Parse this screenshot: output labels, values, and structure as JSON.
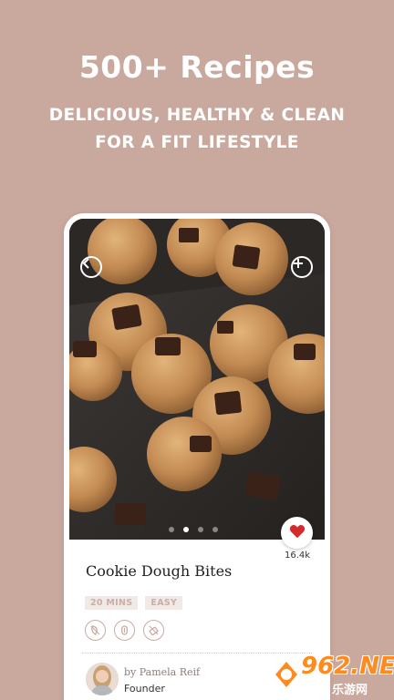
{
  "promo": {
    "headline": "500+ Recipes",
    "subline_1": "DELICIOUS, HEALTHY & CLEAN",
    "subline_2": "FOR A FIT LIFESTYLE"
  },
  "recipe": {
    "title": "Cookie Dough Bites",
    "likes": "16.4k",
    "tags": [
      "20 MINS",
      "EASY"
    ],
    "property_icons": [
      "vegan-icon",
      "gluten-free-icon",
      "sugar-free-icon"
    ],
    "author_line": "by Pamela Reif",
    "author_role": "Founder"
  },
  "carousel": {
    "total_images": 4,
    "active_index": 1
  },
  "icons": {
    "back": "chevron-left-icon",
    "add": "plus-icon",
    "like": "heart-icon"
  },
  "colors": {
    "background": "#c9a89e",
    "tag_bg": "#f1e9e6",
    "tag_text": "#caaea5",
    "heart": "#d42a2a"
  },
  "watermark": {
    "number": "962.NET",
    "sub": "乐游网"
  }
}
